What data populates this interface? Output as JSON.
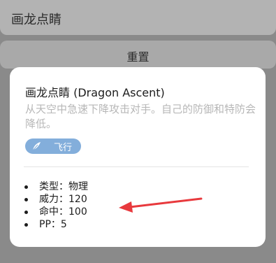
{
  "background": {
    "input_text": "画龙点睛",
    "reset_label": "重置"
  },
  "card": {
    "title": "画龙点睛 (Dragon Ascent)",
    "description": "从天空中急速下降攻击对手。自己的防御和特防会降低。",
    "type_badge": {
      "label": "飞行",
      "icon": "feather-icon",
      "color": "#83aedb"
    },
    "stats": [
      {
        "text": "类型：物理"
      },
      {
        "text": "威力：120"
      },
      {
        "text": "命中：100"
      },
      {
        "text": "PP：5"
      }
    ]
  },
  "annotation": {
    "icon": "red-arrow-icon",
    "color": "#e8393d"
  }
}
